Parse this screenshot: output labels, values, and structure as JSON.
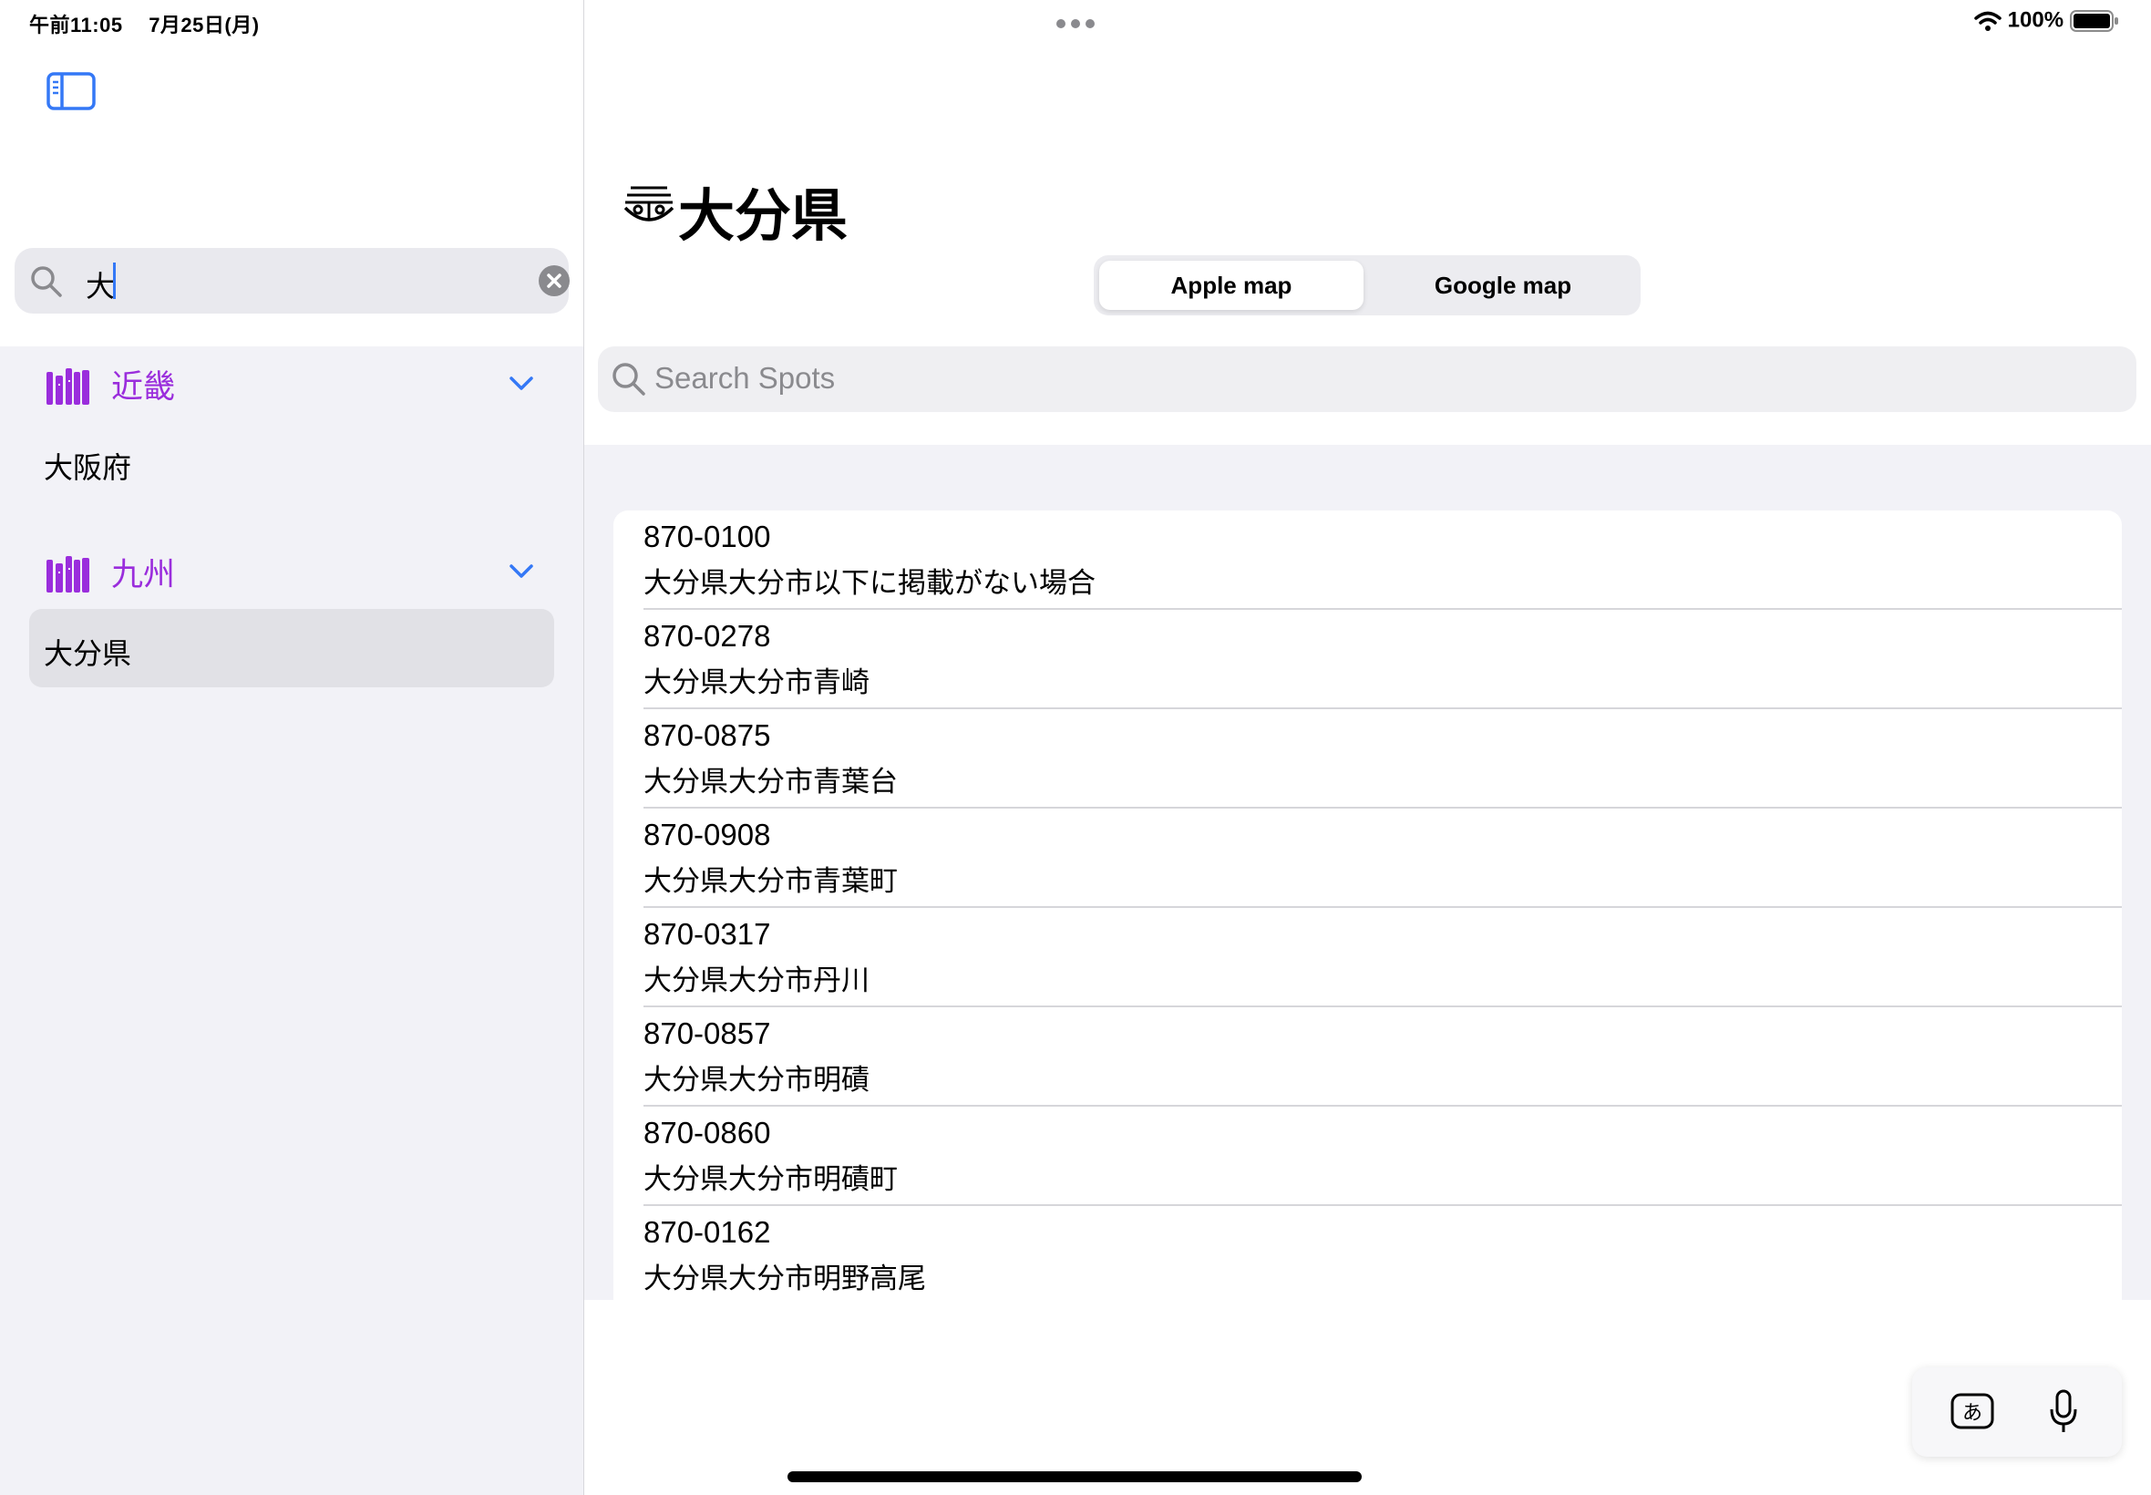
{
  "status_bar": {
    "time": "午前11:05",
    "date": "7月25日(月)",
    "battery": "100%",
    "icons": [
      "wifi-icon",
      "battery-icon",
      "multitask-dots-icon"
    ]
  },
  "sidebar": {
    "toggle_icon": "sidebar-toggle-icon",
    "search": {
      "value": "大",
      "clear_icon": "clear-icon"
    },
    "groups": [
      {
        "title": "近畿",
        "icon": "books-icon",
        "items": [
          {
            "label": "大阪府",
            "selected": false
          }
        ]
      },
      {
        "title": "九州",
        "icon": "books-icon",
        "items": [
          {
            "label": "大分県",
            "selected": true
          }
        ]
      }
    ]
  },
  "detail": {
    "title": "大分県",
    "segment": {
      "options": [
        "Apple map",
        "Google map"
      ],
      "selected": "Apple map"
    },
    "spot_search": {
      "placeholder": "Search Spots"
    },
    "results": [
      {
        "code": "870-0100",
        "address": "大分県大分市以下に掲載がない場合"
      },
      {
        "code": "870-0278",
        "address": "大分県大分市青崎"
      },
      {
        "code": "870-0875",
        "address": "大分県大分市青葉台"
      },
      {
        "code": "870-0908",
        "address": "大分県大分市青葉町"
      },
      {
        "code": "870-0317",
        "address": "大分県大分市丹川"
      },
      {
        "code": "870-0857",
        "address": "大分県大分市明磧"
      },
      {
        "code": "870-0860",
        "address": "大分県大分市明磧町"
      },
      {
        "code": "870-0162",
        "address": "大分県大分市明野高尾"
      }
    ]
  },
  "keyboard_accessory": {
    "kana_label": "あ",
    "icons": [
      "kana-keyboard-icon",
      "microphone-icon"
    ]
  },
  "colors": {
    "accent": "#3478f6",
    "group_purple": "#9a2ddc",
    "sidebar_bg": "#f2f2f7"
  }
}
